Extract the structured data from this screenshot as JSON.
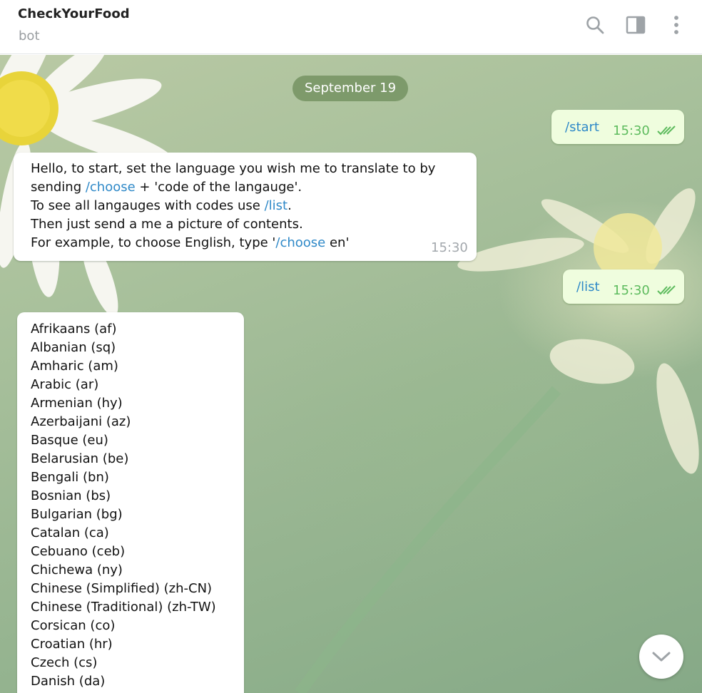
{
  "header": {
    "title": "CheckYourFood",
    "subtitle": "bot",
    "icons": [
      "search-icon",
      "sidebar-toggle-icon",
      "more-vertical-icon"
    ]
  },
  "chat": {
    "date_label": "September 19",
    "messages": [
      {
        "from": "me",
        "text": "/start",
        "time": "15:30",
        "status": "read"
      },
      {
        "from": "bot",
        "line1": "Hello, to start, set the language you wish me to translate to by",
        "line2_pre": "sending ",
        "line2_cmd": "/choose",
        "line2_post": " + 'code of the langauge'.",
        "line3_pre": "To see all langauges with codes use ",
        "line3_cmd": "/list",
        "line3_post": ".",
        "line4": "Then just send a me a picture of contents.",
        "line5_pre": "For example, to choose English, type '",
        "line5_cmd": "/choose",
        "line5_post": " en'",
        "time": "15:30"
      },
      {
        "from": "me",
        "text": "/list",
        "time": "15:30",
        "status": "read"
      }
    ],
    "languages": [
      "Afrikaans (af)",
      "Albanian (sq)",
      "Amharic (am)",
      "Arabic (ar)",
      "Armenian (hy)",
      "Azerbaijani (az)",
      "Basque (eu)",
      "Belarusian (be)",
      "Bengali (bn)",
      "Bosnian (bs)",
      "Bulgarian (bg)",
      "Catalan (ca)",
      "Cebuano (ceb)",
      "Chichewa (ny)",
      "Chinese (Simplified) (zh-CN)",
      "Chinese (Traditional) (zh-TW)",
      "Corsican (co)",
      "Croatian (hr)",
      "Czech (cs)",
      "Danish (da)"
    ]
  },
  "colors": {
    "accent_link": "#2f89c8",
    "out_bubble": "#effdde",
    "out_meta": "#5dbb5d",
    "date_pill": "#708e5c"
  }
}
